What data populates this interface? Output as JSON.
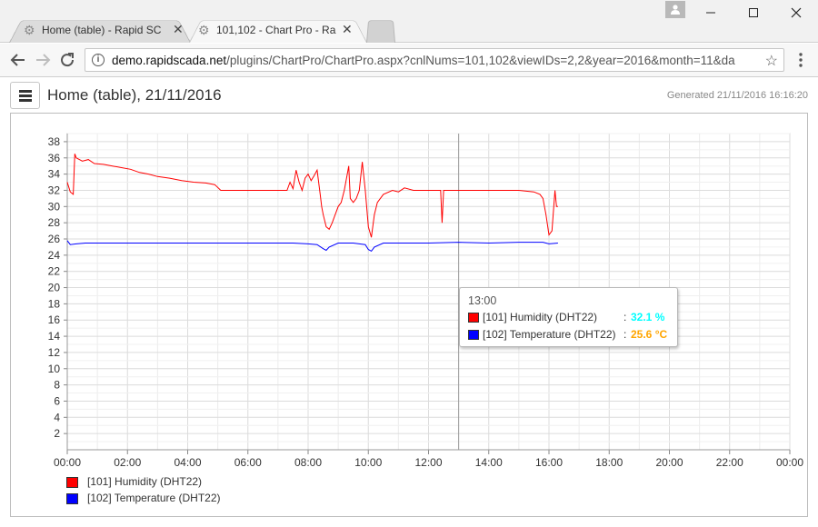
{
  "browser": {
    "tabs": [
      {
        "title": "Home (table) - Rapid SC",
        "active": false
      },
      {
        "title": "101,102 - Chart Pro - Ra",
        "active": true
      }
    ],
    "url_host": "demo.rapidscada.net",
    "url_path": "/plugins/ChartPro/ChartPro.aspx?cnlNums=101,102&viewIDs=2,2&year=2016&month=11&da"
  },
  "page": {
    "title": "Home (table), 21/11/2016",
    "generated": "Generated 21/11/2016 16:16:20"
  },
  "tooltip": {
    "time": "13:00",
    "rows": [
      {
        "name": "[101] Humidity (DHT22)",
        "colon": ":",
        "value": "32.1 %",
        "value_color": "#00ffff"
      },
      {
        "name": "[102] Temperature (DHT22)",
        "colon": ":",
        "value": "25.6 °C",
        "value_color": "#ffa500"
      }
    ]
  },
  "chart_data": {
    "type": "line",
    "x_unit": "time of day (hours)",
    "xlim": [
      0,
      24
    ],
    "ylim": [
      0,
      39
    ],
    "x_ticks": [
      "00:00",
      "02:00",
      "04:00",
      "06:00",
      "08:00",
      "10:00",
      "12:00",
      "14:00",
      "16:00",
      "18:00",
      "20:00",
      "22:00",
      "00:00"
    ],
    "y_ticks": [
      2,
      4,
      6,
      8,
      10,
      12,
      14,
      16,
      18,
      20,
      22,
      24,
      26,
      28,
      30,
      32,
      34,
      36,
      38
    ],
    "grid": true,
    "cursor_x": 13.0,
    "series": [
      {
        "name": "[101] Humidity (DHT22)",
        "color": "#ff0000",
        "points": [
          [
            0.0,
            33.0
          ],
          [
            0.1,
            31.8
          ],
          [
            0.2,
            31.5
          ],
          [
            0.25,
            36.5
          ],
          [
            0.3,
            36.0
          ],
          [
            0.4,
            35.8
          ],
          [
            0.5,
            35.6
          ],
          [
            0.7,
            35.8
          ],
          [
            0.9,
            35.3
          ],
          [
            1.2,
            35.2
          ],
          [
            1.5,
            35.0
          ],
          [
            1.8,
            34.8
          ],
          [
            2.1,
            34.6
          ],
          [
            2.4,
            34.2
          ],
          [
            2.7,
            34.0
          ],
          [
            3.0,
            33.7
          ],
          [
            3.4,
            33.5
          ],
          [
            3.8,
            33.2
          ],
          [
            4.2,
            33.0
          ],
          [
            4.6,
            32.9
          ],
          [
            4.9,
            32.7
          ],
          [
            5.1,
            32.0
          ],
          [
            5.6,
            32.0
          ],
          [
            6.0,
            32.0
          ],
          [
            6.5,
            32.0
          ],
          [
            7.0,
            32.0
          ],
          [
            7.3,
            32.0
          ],
          [
            7.4,
            33.0
          ],
          [
            7.5,
            32.2
          ],
          [
            7.6,
            34.5
          ],
          [
            7.7,
            33.0
          ],
          [
            7.8,
            32.0
          ],
          [
            7.9,
            33.5
          ],
          [
            8.0,
            34.0
          ],
          [
            8.1,
            33.2
          ],
          [
            8.2,
            33.8
          ],
          [
            8.3,
            34.5
          ],
          [
            8.4,
            31.5
          ],
          [
            8.45,
            30.0
          ],
          [
            8.5,
            29.0
          ],
          [
            8.6,
            27.5
          ],
          [
            8.7,
            27.2
          ],
          [
            8.8,
            28.0
          ],
          [
            8.9,
            29.0
          ],
          [
            9.0,
            30.0
          ],
          [
            9.1,
            30.5
          ],
          [
            9.2,
            32.0
          ],
          [
            9.3,
            34.0
          ],
          [
            9.35,
            35.0
          ],
          [
            9.4,
            31.0
          ],
          [
            9.5,
            30.5
          ],
          [
            9.6,
            31.0
          ],
          [
            9.7,
            32.0
          ],
          [
            9.8,
            35.5
          ],
          [
            9.9,
            32.0
          ],
          [
            10.0,
            27.5
          ],
          [
            10.1,
            26.2
          ],
          [
            10.2,
            29.0
          ],
          [
            10.3,
            30.5
          ],
          [
            10.5,
            31.5
          ],
          [
            10.8,
            32.0
          ],
          [
            11.0,
            31.8
          ],
          [
            11.2,
            32.3
          ],
          [
            11.5,
            32.0
          ],
          [
            12.0,
            32.0
          ],
          [
            12.4,
            32.0
          ],
          [
            12.45,
            28.0
          ],
          [
            12.5,
            32.0
          ],
          [
            13.0,
            32.0
          ],
          [
            13.5,
            32.0
          ],
          [
            14.0,
            32.0
          ],
          [
            14.5,
            32.0
          ],
          [
            15.0,
            32.0
          ],
          [
            15.5,
            31.8
          ],
          [
            15.7,
            31.5
          ],
          [
            15.8,
            31.0
          ],
          [
            15.9,
            29.0
          ],
          [
            16.0,
            26.5
          ],
          [
            16.1,
            27.0
          ],
          [
            16.2,
            32.0
          ],
          [
            16.25,
            30.0
          ],
          [
            16.3,
            30.0
          ]
        ]
      },
      {
        "name": "[102] Temperature (DHT22)",
        "color": "#0000ff",
        "points": [
          [
            0.0,
            25.8
          ],
          [
            0.1,
            25.3
          ],
          [
            0.3,
            25.4
          ],
          [
            0.6,
            25.5
          ],
          [
            1.0,
            25.5
          ],
          [
            2.0,
            25.5
          ],
          [
            3.0,
            25.5
          ],
          [
            4.0,
            25.5
          ],
          [
            5.0,
            25.5
          ],
          [
            6.0,
            25.5
          ],
          [
            7.0,
            25.5
          ],
          [
            7.5,
            25.5
          ],
          [
            8.0,
            25.4
          ],
          [
            8.3,
            25.3
          ],
          [
            8.5,
            24.8
          ],
          [
            8.6,
            24.6
          ],
          [
            8.7,
            25.0
          ],
          [
            9.0,
            25.5
          ],
          [
            9.5,
            25.5
          ],
          [
            9.9,
            25.3
          ],
          [
            10.0,
            24.7
          ],
          [
            10.1,
            24.5
          ],
          [
            10.2,
            25.0
          ],
          [
            10.5,
            25.5
          ],
          [
            11.0,
            25.5
          ],
          [
            12.0,
            25.5
          ],
          [
            13.0,
            25.6
          ],
          [
            14.0,
            25.5
          ],
          [
            15.0,
            25.6
          ],
          [
            15.8,
            25.6
          ],
          [
            16.0,
            25.4
          ],
          [
            16.3,
            25.5
          ]
        ]
      }
    ]
  }
}
